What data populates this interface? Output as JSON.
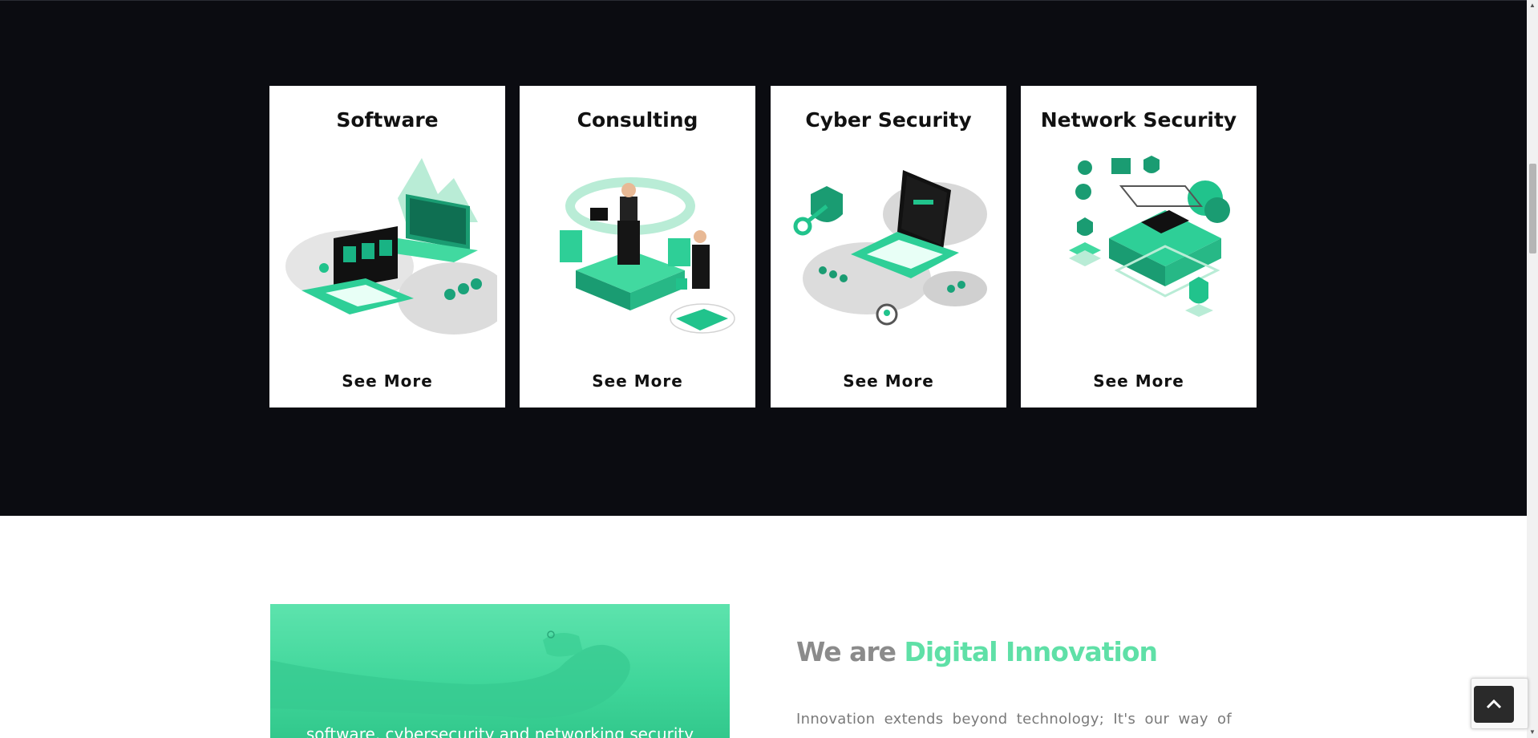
{
  "services": {
    "cards": [
      {
        "title": "Software",
        "link_label": "See More"
      },
      {
        "title": "Consulting",
        "link_label": "See More"
      },
      {
        "title": "Cyber Security",
        "link_label": "See More"
      },
      {
        "title": "Network Security",
        "link_label": "See More"
      }
    ]
  },
  "about": {
    "title_part1": "We are",
    "title_part2": "Digital Innovation",
    "text": "Innovation extends beyond technology; It's our way of",
    "image_caption": "software, cybersecurity and networking security"
  },
  "colors": {
    "dark_bg": "#0b0c11",
    "accent": "#5fe0a7"
  },
  "icons": {
    "back_to_top": "chevron-up-icon",
    "recaptcha": "recaptcha-icon"
  }
}
